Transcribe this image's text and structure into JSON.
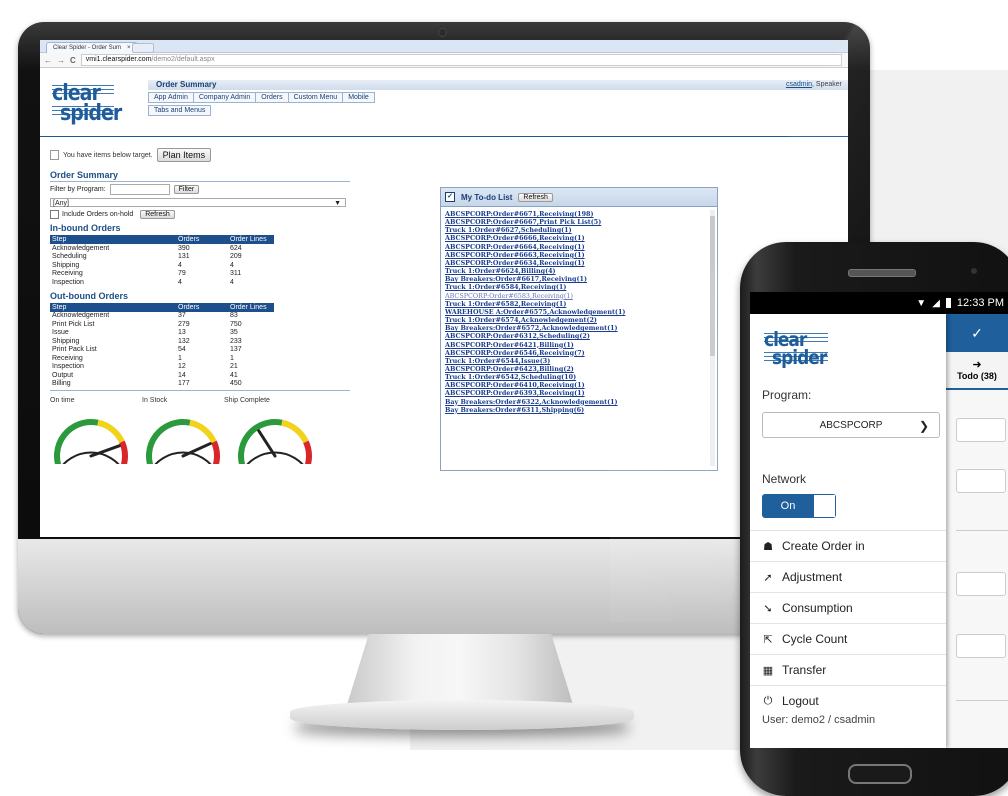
{
  "browser": {
    "tab_title": "Clear Spider - Order Sum",
    "tab_close": "×",
    "url_host": "vmi1.clearspider.com",
    "url_path": "/demo2/default.aspx"
  },
  "app": {
    "logo_line1": "clear",
    "logo_line2": "spider",
    "page_title": "Order Summary",
    "user_name": "csadmin",
    "user_suffix": ", Speaker",
    "menu": [
      "App Admin",
      "Company Admin",
      "Orders",
      "Custom Menu",
      "Mobile"
    ],
    "submenu": "Tabs and Menus"
  },
  "summary": {
    "alert_text": "You have items below target.",
    "plan_button": "Plan Items",
    "heading": "Order Summary",
    "filter_label": "Filter by Program:",
    "filter_button": "Filter",
    "program_select": "[Any]",
    "onhold_label": "Include Orders on-hold",
    "refresh_button": "Refresh"
  },
  "inbound": {
    "heading": "In-bound Orders",
    "headers": [
      "Step",
      "Orders",
      "Order Lines"
    ],
    "rows": [
      [
        "Acknowledgement",
        "390",
        "624"
      ],
      [
        "Scheduling",
        "131",
        "209"
      ],
      [
        "Shipping",
        "4",
        "4"
      ],
      [
        "Receiving",
        "79",
        "311"
      ],
      [
        "Inspection",
        "4",
        "4"
      ]
    ]
  },
  "outbound": {
    "heading": "Out-bound Orders",
    "headers": [
      "Step",
      "Orders",
      "Order Lines"
    ],
    "rows": [
      [
        "Acknowledgement",
        "37",
        "83"
      ],
      [
        "Print Pick List",
        "279",
        "750"
      ],
      [
        "Issue",
        "13",
        "35"
      ],
      [
        "Shipping",
        "132",
        "233"
      ],
      [
        "Print Pack List",
        "54",
        "137"
      ],
      [
        "Receiving",
        "1",
        "1"
      ],
      [
        "Inspection",
        "12",
        "21"
      ],
      [
        "Output",
        "14",
        "41"
      ],
      [
        "Billing",
        "177",
        "450"
      ]
    ]
  },
  "gauges": {
    "labels": [
      "On time",
      "In Stock",
      "Ship Complete"
    ],
    "levels": [
      0.8,
      0.78,
      0.36
    ],
    "colors": {
      "green": "#2a9a3c",
      "yellow": "#f2d21b",
      "red": "#d9262a",
      "outline": "#222222"
    }
  },
  "todo": {
    "title": "My To-do List",
    "refresh_button": "Refresh",
    "items": [
      "ABCSPCORP:Order#6671,Receiving(198)",
      "ABCSPCORP:Order#6667,Print Pick List(5)",
      "Truck 1:Order#6627,Scheduling(1)",
      "ABCSPCORP:Order#6666,Receiving(1)",
      "ABCSPCORP:Order#6664,Receiving(1)",
      "ABCSPCORP:Order#6663,Receiving(1)",
      "ABCSPCORP:Order#6634,Receiving(1)",
      "Truck 1:Order#6624,Billing(4)",
      "Bay Breakers:Order#6617,Receiving(1)",
      "Truck 1:Order#6584,Receiving(1)",
      "ABCSPCORP:Order#6583,Receiving(1)",
      "Truck 1:Order#6582,Receiving(1)",
      "WAREHOUSE A:Order#6575,Acknowledgement(1)",
      "Truck 1:Order#6574,Acknowledgement(2)",
      "Bay Breakers:Order#6572,Acknowledgement(1)",
      "ABCSPCORP:Order#6312,Scheduling(2)",
      "ABCSPCORP:Order#6421,Billing(1)",
      "ABCSPCORP:Order#6546,Receiving(7)",
      "Truck 1:Order#6544,Issue(3)",
      "ABCSPCORP:Order#6423,Billing(2)",
      "Truck 1:Order#6542,Scheduling(10)",
      "ABCSPCORP:Order#6410,Receiving(1)",
      "ABCSPCORP:Order#6393,Receiving(1)",
      "Bay Breakers:Order#6322,Acknowledgement(1)",
      "Bay Breakers:Order#6311,Shipping(6)"
    ],
    "visited_index": 10
  },
  "phone": {
    "time": "12:33 PM",
    "logo_line1": "clear",
    "logo_line2": "spider",
    "program_label": "Program:",
    "program_value": "ABCSPCORP",
    "network_label": "Network",
    "toggle_label": "On",
    "menu": [
      {
        "label": "Create Order in",
        "icon": "shopping-bag-icon",
        "glyph": "☗"
      },
      {
        "label": "Adjustment",
        "icon": "arrow-up-right-icon",
        "glyph": "➚"
      },
      {
        "label": "Consumption",
        "icon": "arrow-down-right-icon",
        "glyph": "➘"
      },
      {
        "label": "Cycle Count",
        "icon": "export-icon",
        "glyph": "⇱"
      },
      {
        "label": "Transfer",
        "icon": "grid-icon",
        "glyph": "▦"
      },
      {
        "label": "Logout",
        "icon": "power-icon",
        "glyph": "⏻"
      }
    ],
    "user_text": "User: demo2 / csadmin",
    "header_check": "✓",
    "todo_arrow": "➜",
    "todo_tab": "Todo (38)"
  }
}
